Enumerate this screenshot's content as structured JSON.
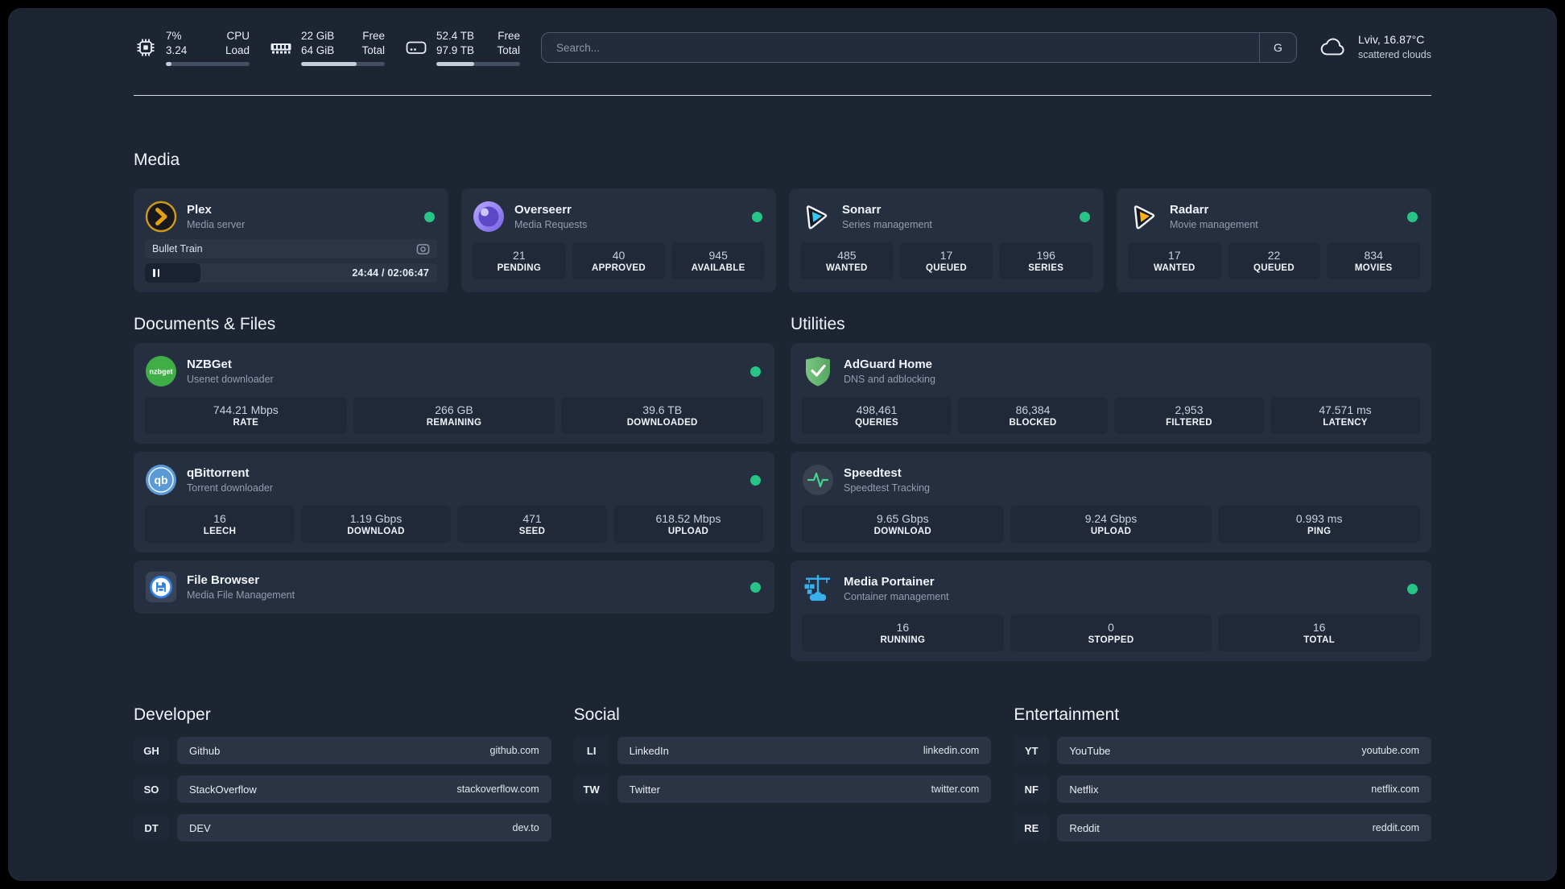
{
  "colors": {
    "accent_green": "#26c485",
    "app_bg": "#1d2533",
    "card_bg": "#262f3f"
  },
  "header": {
    "metrics": [
      {
        "icon": "cpu-icon",
        "values": [
          "7%",
          "3.24"
        ],
        "labels": [
          "CPU",
          "Load"
        ],
        "progress": "7%"
      },
      {
        "icon": "ram-icon",
        "values": [
          "22 GiB",
          "64 GiB"
        ],
        "labels": [
          "Free",
          "Total"
        ],
        "progress": "66%"
      },
      {
        "icon": "disk-icon",
        "values": [
          "52.4 TB",
          "97.9 TB"
        ],
        "labels": [
          "Free",
          "Total"
        ],
        "progress": "45%"
      }
    ],
    "search": {
      "placeholder": "Search...",
      "provider_label": "G"
    },
    "weather": {
      "icon": "cloud-icon",
      "location": "Lviv, 16.87°C",
      "condition": "scattered clouds"
    }
  },
  "media": {
    "title": "Media",
    "plex": {
      "name": "Plex",
      "desc": "Media server",
      "icon": "plex-icon",
      "status": "online",
      "now_playing": {
        "title": "Bullet Train",
        "time": "24:44 / 02:06:47",
        "progress": "19%"
      }
    },
    "overseerr": {
      "name": "Overseerr",
      "desc": "Media Requests",
      "icon": "overseerr-icon",
      "status": "online",
      "stats": [
        {
          "value": "21",
          "label": "PENDING"
        },
        {
          "value": "40",
          "label": "APPROVED"
        },
        {
          "value": "945",
          "label": "AVAILABLE"
        }
      ]
    },
    "sonarr": {
      "name": "Sonarr",
      "desc": "Series management",
      "icon": "sonarr-icon",
      "status": "online",
      "stats": [
        {
          "value": "485",
          "label": "WANTED"
        },
        {
          "value": "17",
          "label": "QUEUED"
        },
        {
          "value": "196",
          "label": "SERIES"
        }
      ]
    },
    "radarr": {
      "name": "Radarr",
      "desc": "Movie management",
      "icon": "radarr-icon",
      "status": "online",
      "stats": [
        {
          "value": "17",
          "label": "WANTED"
        },
        {
          "value": "22",
          "label": "QUEUED"
        },
        {
          "value": "834",
          "label": "MOVIES"
        }
      ]
    }
  },
  "documents": {
    "title": "Documents & Files",
    "nzbget": {
      "name": "NZBGet",
      "desc": "Usenet downloader",
      "icon": "nzbget-icon",
      "status": "online",
      "stats": [
        {
          "value": "744.21 Mbps",
          "label": "RATE"
        },
        {
          "value": "266 GB",
          "label": "REMAINING"
        },
        {
          "value": "39.6 TB",
          "label": "DOWNLOADED"
        }
      ]
    },
    "qbittorrent": {
      "name": "qBittorrent",
      "desc": "Torrent downloader",
      "icon": "qbittorrent-icon",
      "status": "online",
      "stats": [
        {
          "value": "16",
          "label": "LEECH"
        },
        {
          "value": "1.19 Gbps",
          "label": "DOWNLOAD"
        },
        {
          "value": "471",
          "label": "SEED"
        },
        {
          "value": "618.52 Mbps",
          "label": "UPLOAD"
        }
      ]
    },
    "filebrowser": {
      "name": "File Browser",
      "desc": "Media File Management",
      "icon": "filebrowser-icon",
      "status": "online"
    }
  },
  "utilities": {
    "title": "Utilities",
    "adguard": {
      "name": "AdGuard Home",
      "desc": "DNS and adblocking",
      "icon": "adguard-icon",
      "stats": [
        {
          "value": "498,461",
          "label": "QUERIES"
        },
        {
          "value": "86,384",
          "label": "BLOCKED"
        },
        {
          "value": "2,953",
          "label": "FILTERED"
        },
        {
          "value": "47.571 ms",
          "label": "LATENCY"
        }
      ]
    },
    "speedtest": {
      "name": "Speedtest",
      "desc": "Speedtest Tracking",
      "icon": "speedtest-icon",
      "stats": [
        {
          "value": "9.65 Gbps",
          "label": "DOWNLOAD"
        },
        {
          "value": "9.24 Gbps",
          "label": "UPLOAD"
        },
        {
          "value": "0.993 ms",
          "label": "PING"
        }
      ]
    },
    "portainer": {
      "name": "Media Portainer",
      "desc": "Container management",
      "icon": "portainer-icon",
      "status": "online",
      "stats": [
        {
          "value": "16",
          "label": "RUNNING"
        },
        {
          "value": "0",
          "label": "STOPPED"
        },
        {
          "value": "16",
          "label": "TOTAL"
        }
      ]
    }
  },
  "bookmarks": {
    "developer": {
      "title": "Developer",
      "links": [
        {
          "abbr": "GH",
          "name": "Github",
          "url": "github.com"
        },
        {
          "abbr": "SO",
          "name": "StackOverflow",
          "url": "stackoverflow.com"
        },
        {
          "abbr": "DT",
          "name": "DEV",
          "url": "dev.to"
        }
      ]
    },
    "social": {
      "title": "Social",
      "links": [
        {
          "abbr": "LI",
          "name": "LinkedIn",
          "url": "linkedin.com"
        },
        {
          "abbr": "TW",
          "name": "Twitter",
          "url": "twitter.com"
        }
      ]
    },
    "entertainment": {
      "title": "Entertainment",
      "links": [
        {
          "abbr": "YT",
          "name": "YouTube",
          "url": "youtube.com"
        },
        {
          "abbr": "NF",
          "name": "Netflix",
          "url": "netflix.com"
        },
        {
          "abbr": "RE",
          "name": "Reddit",
          "url": "reddit.com"
        }
      ]
    }
  }
}
